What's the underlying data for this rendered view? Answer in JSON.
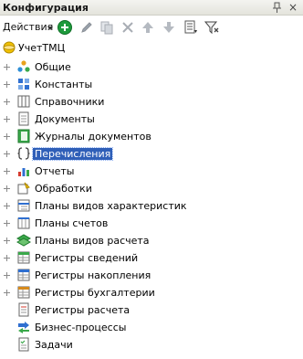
{
  "window": {
    "title": "Конфигурация",
    "close_glyph": "×",
    "pin_icon": "pin-icon"
  },
  "toolbar": {
    "actions_label": "Действия",
    "icons": [
      "add-icon",
      "edit-icon",
      "copy-icon",
      "delete-icon",
      "move-up-icon",
      "move-down-icon",
      "list-icon",
      "filter-icon"
    ],
    "accent": "#1e9a3c"
  },
  "tree": {
    "root_label": "УчетТМЦ",
    "items": [
      {
        "label": "Общие",
        "icon": "common-icon"
      },
      {
        "label": "Константы",
        "icon": "constants-icon"
      },
      {
        "label": "Справочники",
        "icon": "catalogs-icon"
      },
      {
        "label": "Документы",
        "icon": "documents-icon"
      },
      {
        "label": "Журналы документов",
        "icon": "document-journals-icon"
      },
      {
        "label": "Перечисления",
        "icon": "enumerations-icon",
        "selected": true
      },
      {
        "label": "Отчеты",
        "icon": "reports-icon"
      },
      {
        "label": "Обработки",
        "icon": "data-processors-icon"
      },
      {
        "label": "Планы видов характеристик",
        "icon": "characteristic-types-icon"
      },
      {
        "label": "Планы счетов",
        "icon": "charts-of-accounts-icon"
      },
      {
        "label": "Планы видов расчета",
        "icon": "calculation-types-icon"
      },
      {
        "label": "Регистры сведений",
        "icon": "information-registers-icon"
      },
      {
        "label": "Регистры накопления",
        "icon": "accumulation-registers-icon"
      },
      {
        "label": "Регистры бухгалтерии",
        "icon": "accounting-registers-icon"
      },
      {
        "label": "Регистры расчета",
        "icon": "calculation-registers-icon"
      },
      {
        "label": "Бизнес-процессы",
        "icon": "business-processes-icon"
      },
      {
        "label": "Задачи",
        "icon": "tasks-icon"
      }
    ],
    "selection_color": "#2f5fb8"
  }
}
